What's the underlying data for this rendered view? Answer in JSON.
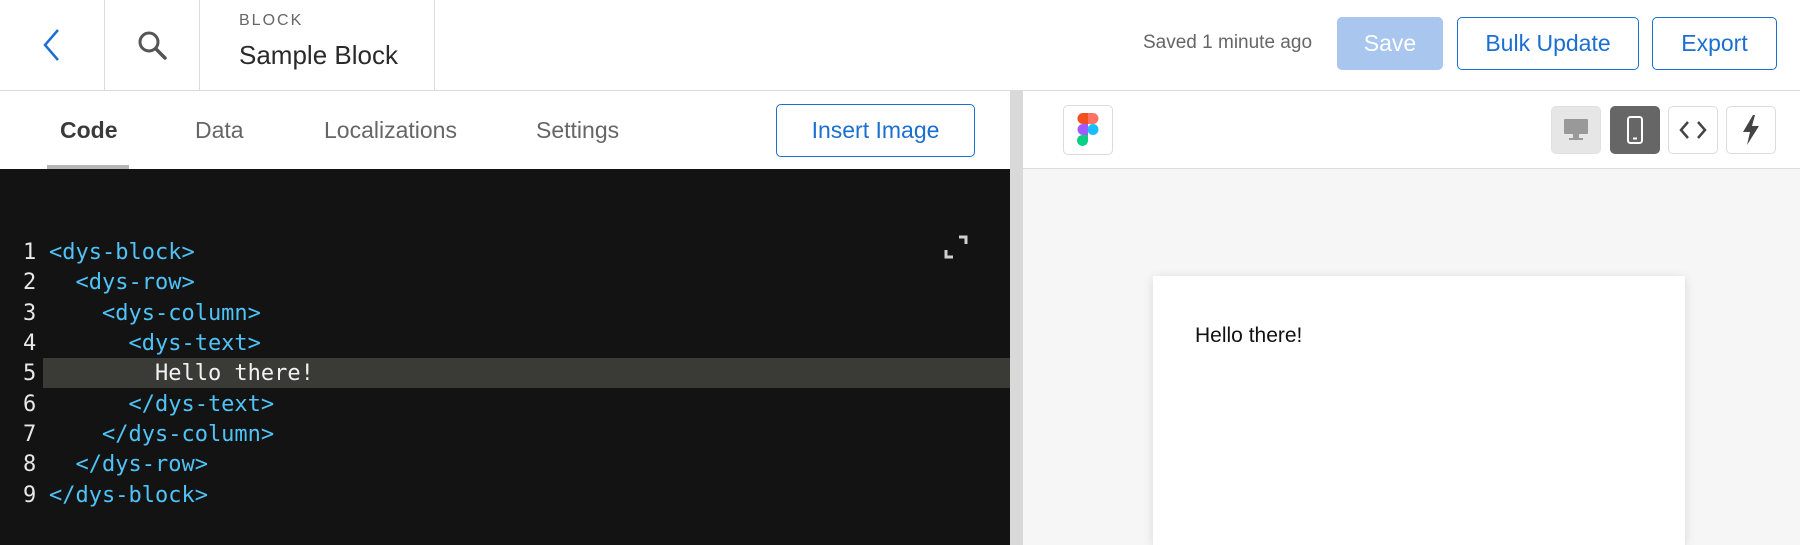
{
  "header": {
    "kind_label": "BLOCK",
    "title": "Sample Block",
    "saved_status": "Saved 1 minute ago",
    "save_label": "Save",
    "bulk_update_label": "Bulk Update",
    "export_label": "Export"
  },
  "editor": {
    "tabs": [
      {
        "label": "Code",
        "active": true
      },
      {
        "label": "Data",
        "active": false
      },
      {
        "label": "Localizations",
        "active": false
      },
      {
        "label": "Settings",
        "active": false
      }
    ],
    "insert_image_label": "Insert Image",
    "lines": [
      {
        "num": "1",
        "text": "<dys-block>"
      },
      {
        "num": "2",
        "text": "  <dys-row>"
      },
      {
        "num": "3",
        "text": "    <dys-column>"
      },
      {
        "num": "4",
        "text": "      <dys-text>"
      },
      {
        "num": "5",
        "text": "        Hello there!"
      },
      {
        "num": "6",
        "text": "      </dys-text>"
      },
      {
        "num": "7",
        "text": "    </dys-column>"
      },
      {
        "num": "8",
        "text": "  </dys-row>"
      },
      {
        "num": "9",
        "text": "</dys-block>"
      }
    ],
    "highlighted_line": 5
  },
  "preview": {
    "content_text": "Hello there!",
    "device_mode": "mobile"
  },
  "colors": {
    "accent": "#1a6fd0",
    "save_disabled": "#a8c6ee",
    "editor_bg": "#131313",
    "tag_color": "#4fc3f7"
  }
}
